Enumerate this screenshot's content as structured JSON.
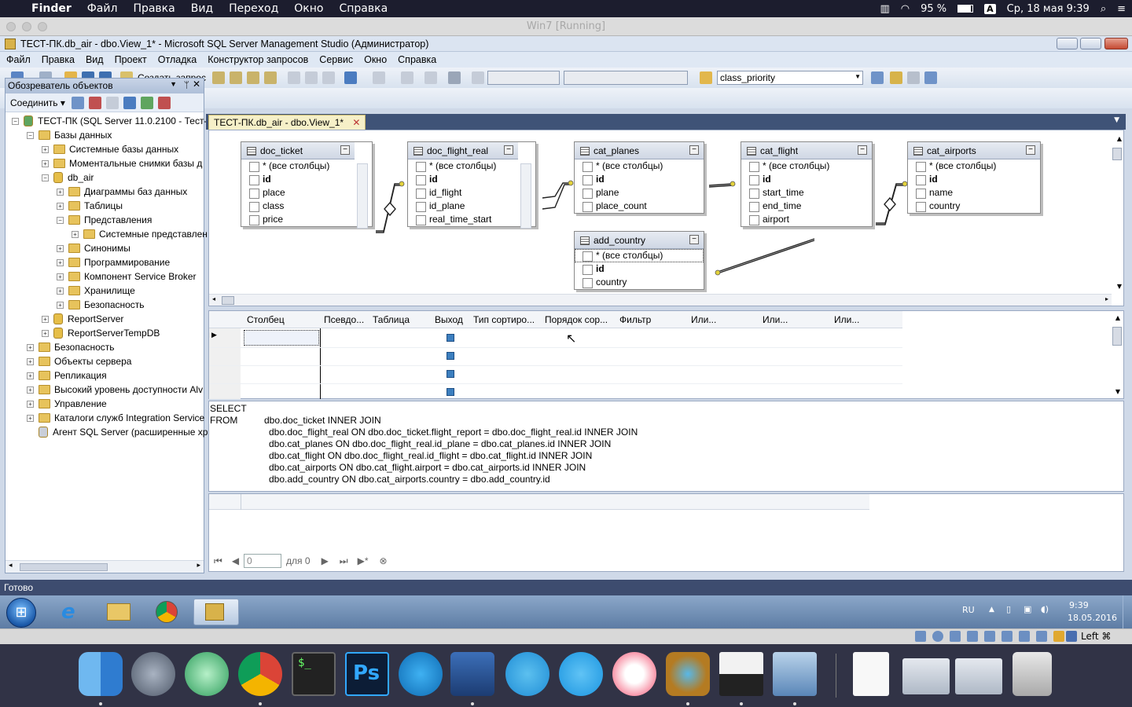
{
  "mac_menubar": {
    "app_name": "Finder",
    "menus": [
      "Файл",
      "Правка",
      "Вид",
      "Переход",
      "Окно",
      "Справка"
    ],
    "battery": "95 %",
    "input_lang": "A",
    "datetime": "Ср, 18 мая  9:39"
  },
  "vbox": {
    "title": "Win7 [Running]"
  },
  "window": {
    "title": "ТЕСТ-ПК.db_air - dbo.View_1* - Microsoft SQL Server Management Studio (Администратор)",
    "menu": [
      "Файл",
      "Правка",
      "Вид",
      "Проект",
      "Отладка",
      "Конструктор запросов",
      "Сервис",
      "Окно",
      "Справка"
    ],
    "toolbar": {
      "new_query": "Создать запрос",
      "combo_value": "class_priority"
    }
  },
  "object_explorer": {
    "header": "Обозреватель объектов",
    "connect": "Соединить",
    "tree": [
      {
        "label": "ТЕСТ-ПК (SQL Server 11.0.2100 - Тест-П",
        "level": 0,
        "kind": "server",
        "exp": "-"
      },
      {
        "label": "Базы данных",
        "level": 1,
        "kind": "folder",
        "exp": "-"
      },
      {
        "label": "Системные базы данных",
        "level": 2,
        "kind": "folder",
        "exp": "+"
      },
      {
        "label": "Моментальные снимки базы д",
        "level": 2,
        "kind": "folder",
        "exp": "+"
      },
      {
        "label": "db_air",
        "level": 2,
        "kind": "db",
        "exp": "-"
      },
      {
        "label": "Диаграммы баз данных",
        "level": 3,
        "kind": "folder",
        "exp": "+"
      },
      {
        "label": "Таблицы",
        "level": 3,
        "kind": "folder",
        "exp": "+"
      },
      {
        "label": "Представления",
        "level": 3,
        "kind": "folder",
        "exp": "-"
      },
      {
        "label": "Системные представлен",
        "level": 4,
        "kind": "folder",
        "exp": "+"
      },
      {
        "label": "Синонимы",
        "level": 3,
        "kind": "folder",
        "exp": "+"
      },
      {
        "label": "Программирование",
        "level": 3,
        "kind": "folder",
        "exp": "+"
      },
      {
        "label": "Компонент Service Broker",
        "level": 3,
        "kind": "folder",
        "exp": "+"
      },
      {
        "label": "Хранилище",
        "level": 3,
        "kind": "folder",
        "exp": "+"
      },
      {
        "label": "Безопасность",
        "level": 3,
        "kind": "folder",
        "exp": "+"
      },
      {
        "label": "ReportServer",
        "level": 2,
        "kind": "db",
        "exp": "+"
      },
      {
        "label": "ReportServerTempDB",
        "level": 2,
        "kind": "db",
        "exp": "+"
      },
      {
        "label": "Безопасность",
        "level": 1,
        "kind": "folder",
        "exp": "+"
      },
      {
        "label": "Объекты сервера",
        "level": 1,
        "kind": "folder",
        "exp": "+"
      },
      {
        "label": "Репликация",
        "level": 1,
        "kind": "folder",
        "exp": "+"
      },
      {
        "label": "Высокий уровень доступности Alv",
        "level": 1,
        "kind": "folder",
        "exp": "+"
      },
      {
        "label": "Управление",
        "level": 1,
        "kind": "folder",
        "exp": "+"
      },
      {
        "label": "Каталоги служб Integration Service",
        "level": 1,
        "kind": "folder",
        "exp": "+"
      },
      {
        "label": "Агент SQL Server (расширенные хр",
        "level": 1,
        "kind": "agent",
        "exp": ""
      }
    ]
  },
  "document_tab": "ТЕСТ-ПК.db_air - dbo.View_1*",
  "diagram": {
    "tables": [
      {
        "name": "doc_ticket",
        "rows": [
          "* (все столбцы)",
          "id",
          "place",
          "class",
          "price"
        ],
        "bold": [
          1
        ],
        "scroll": true
      },
      {
        "name": "doc_flight_real",
        "rows": [
          "* (все столбцы)",
          "id",
          "id_flight",
          "id_plane",
          "real_time_start"
        ],
        "bold": [
          1
        ],
        "scroll": true
      },
      {
        "name": "cat_planes",
        "rows": [
          "* (все столбцы)",
          "id",
          "plane",
          "place_count"
        ],
        "bold": [
          1
        ],
        "scroll": false
      },
      {
        "name": "add_country",
        "rows": [
          "* (все столбцы)",
          "id",
          "country"
        ],
        "bold": [
          1
        ],
        "scroll": false,
        "selected": true
      },
      {
        "name": "cat_flight",
        "rows": [
          "* (все столбцы)",
          "id",
          "start_time",
          "end_time",
          "airport"
        ],
        "bold": [
          1
        ],
        "scroll": false
      },
      {
        "name": "cat_airports",
        "rows": [
          "* (все столбцы)",
          "id",
          "name",
          "country"
        ],
        "bold": [
          1
        ],
        "scroll": false
      }
    ]
  },
  "criteria_grid": {
    "headers": [
      "Столбец",
      "Псевдо...",
      "Таблица",
      "Выход",
      "Тип сортиро...",
      "Порядок сор...",
      "Фильтр",
      "Или...",
      "Или...",
      "Или..."
    ]
  },
  "sql": {
    "lines": [
      "SELECT",
      "FROM",
      "dbo.doc_ticket INNER JOIN",
      "dbo.doc_flight_real ON dbo.doc_ticket.flight_report = dbo.doc_flight_real.id INNER JOIN",
      "dbo.cat_planes ON dbo.doc_flight_real.id_plane = dbo.cat_planes.id INNER JOIN",
      "dbo.cat_flight ON dbo.doc_flight_real.id_flight = dbo.cat_flight.id INNER JOIN",
      "dbo.cat_airports ON dbo.cat_flight.airport = dbo.cat_airports.id INNER JOIN",
      "dbo.add_country ON dbo.cat_airports.country = dbo.add_country.id"
    ]
  },
  "results_nav": {
    "page_value": "0",
    "of_label": "для 0"
  },
  "status": {
    "text": "Готово"
  },
  "taskbar": {
    "lang": "RU",
    "time": "9:39",
    "date": "18.05.2016"
  },
  "vbox_status": {
    "host_key": "Left ⌘"
  },
  "colors": {
    "menubar": "#1c1d2e",
    "status_bar": "#3d4c6f",
    "tabstrip": "#3f5377",
    "dock": "#2e3042"
  }
}
